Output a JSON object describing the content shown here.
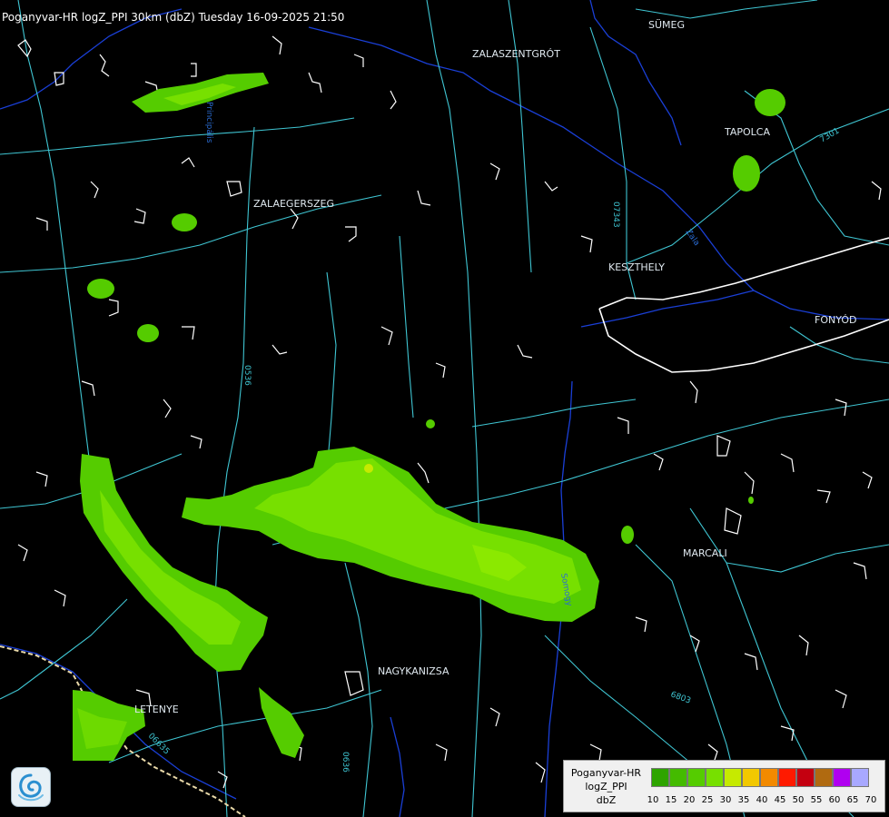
{
  "header": {
    "title": "Poganyvar-HR logZ_PPI 30km (dbZ) Tuesday 16-09-2025 21:50"
  },
  "cities": [
    {
      "name": "SÜMEG"
    },
    {
      "name": "ZALASZENTGRÓT"
    },
    {
      "name": "TAPOLCA"
    },
    {
      "name": "ZALAEGERSZEG"
    },
    {
      "name": "KESZTHELY"
    },
    {
      "name": "FONYÓD"
    },
    {
      "name": "MARCALI"
    },
    {
      "name": "NAGYKANIZSA"
    },
    {
      "name": "LETENYE"
    }
  ],
  "road_labels": [
    "07343",
    "06635",
    "0636",
    "7301",
    "6803",
    "0536"
  ],
  "river_labels": [
    "Zala",
    "Somogy",
    "Principális"
  ],
  "legend": {
    "title_line1": "Poganyvar-HR",
    "title_line2": "logZ_PPI",
    "title_line3": "dbZ",
    "colors": [
      "#2ea400",
      "#44bb00",
      "#55cc00",
      "#77e000",
      "#c6ea00",
      "#f2c800",
      "#f38a00",
      "#ff1a00",
      "#c40010",
      "#b06a10",
      "#b000f0",
      "#a8a8ff"
    ],
    "ticks": [
      "10",
      "15",
      "20",
      "25",
      "30",
      "35",
      "40",
      "45",
      "50",
      "55",
      "60",
      "65",
      "70"
    ]
  },
  "colors": {
    "background": "#000000",
    "roads": "#3fc5d2",
    "rivers": "#1a3fd6",
    "borders": "#ffffff",
    "echo_weak": "#55cc00",
    "echo_light": "#77e000",
    "echo_core": "#c6ea00"
  },
  "logo": {
    "name": "weather-service-logo"
  }
}
